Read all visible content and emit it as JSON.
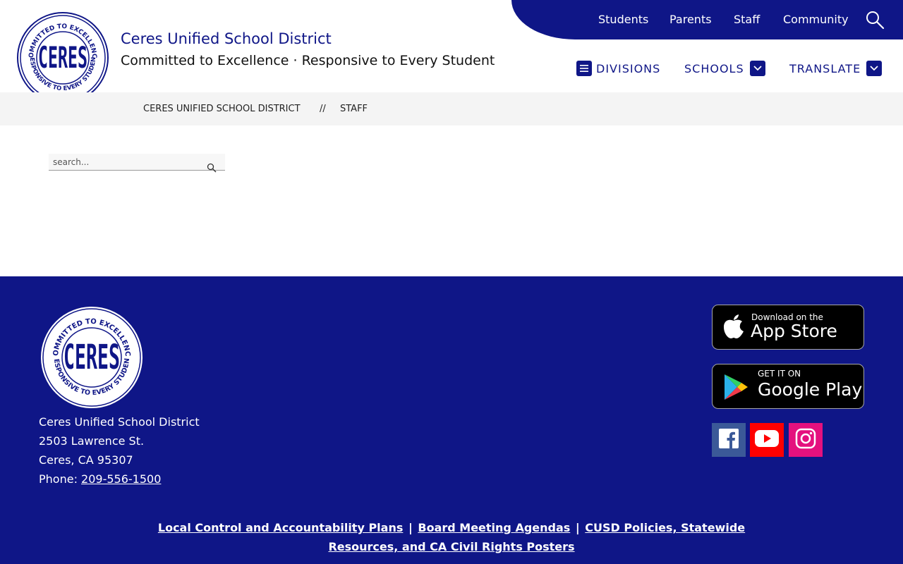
{
  "site": {
    "name": "Ceres Unified School District",
    "tagline": "Committed to Excellence · Responsive to Every Student",
    "brand_color": "#0f1687"
  },
  "logo_seal": {
    "top_text": "COMMITTED TO EXCELLENCE",
    "bottom_text": "RESPONSIVE TO EVERY STUDENT",
    "center_text": "CERES"
  },
  "utility_nav": {
    "items": [
      "Students",
      "Parents",
      "Staff",
      "Community"
    ],
    "search_icon": "search-icon"
  },
  "main_nav": {
    "divisions": "DIVISIONS",
    "schools": "SCHOOLS",
    "translate": "TRANSLATE"
  },
  "breadcrumb": {
    "home": "CERES UNIFIED SCHOOL DISTRICT",
    "separator": "//",
    "current": "STAFF"
  },
  "search": {
    "placeholder": "search..."
  },
  "footer": {
    "address": {
      "name": "Ceres Unified School District",
      "street": "2503 Lawrence St.",
      "city": "Ceres, CA 95307",
      "phone_label": "Phone:",
      "phone": "209-556-1500"
    },
    "app_store": {
      "small": "Download on the",
      "big": "App Store"
    },
    "google_play": {
      "small": "GET IT ON",
      "big": "Google Play"
    },
    "social": {
      "facebook_color": "#3b5998",
      "youtube_color": "#ff0000",
      "instagram_color": "#e4117e"
    },
    "links": {
      "lcap": "Local Control and Accountability Plans",
      "board": "Board Meeting Agendas",
      "policies": "CUSD Policies, Statewide Resources, and CA Civil Rights Posters",
      "separator": "|"
    }
  }
}
